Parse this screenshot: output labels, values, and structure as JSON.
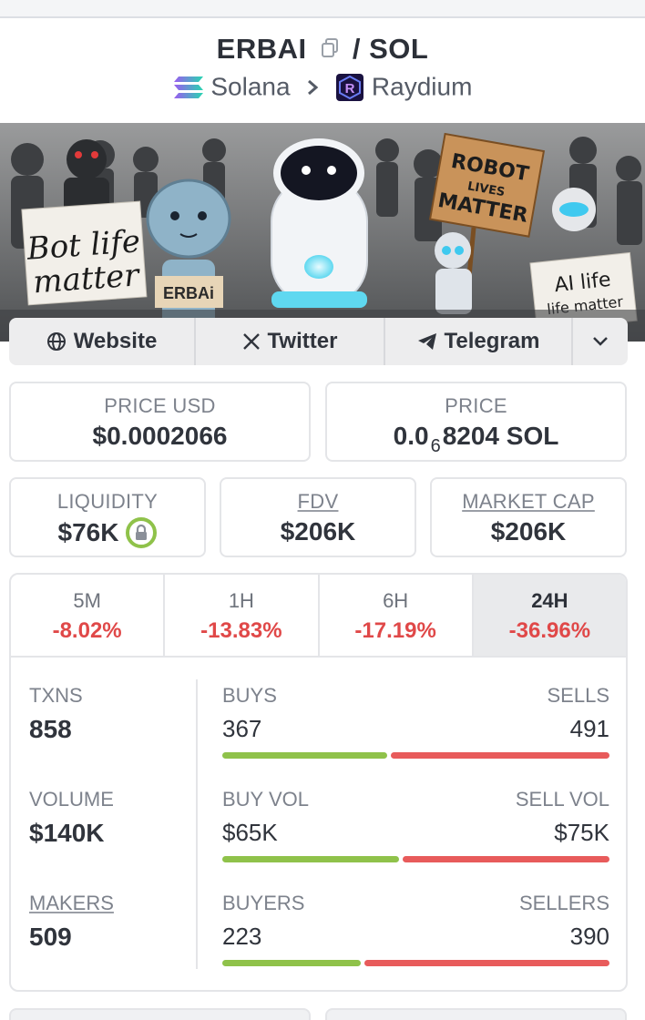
{
  "header": {
    "base_token": "ERBAI",
    "separator": "/",
    "quote_token": "SOL",
    "chain": "Solana",
    "dex": "Raydium"
  },
  "banner": {
    "sign_left": "Bot life matter",
    "sign_center": "ERBAi",
    "sign_top": "ROBOT LIVES MATTER",
    "sign_right": "AI life life matter"
  },
  "links": {
    "website": "Website",
    "twitter": "Twitter",
    "telegram": "Telegram"
  },
  "prices": {
    "usd_label": "PRICE USD",
    "usd_value": "$0.0002066",
    "native_label": "PRICE",
    "native_prefix": "0.0",
    "native_zeros": "6",
    "native_digits": "8204",
    "native_unit": "SOL"
  },
  "metrics": {
    "liquidity_label": "LIQUIDITY",
    "liquidity_value": "$76K",
    "fdv_label": "FDV",
    "fdv_value": "$206K",
    "mcap_label": "MARKET CAP",
    "mcap_value": "$206K"
  },
  "timeframes": [
    {
      "label": "5M",
      "change": "-8.02%"
    },
    {
      "label": "1H",
      "change": "-13.83%"
    },
    {
      "label": "6H",
      "change": "-17.19%"
    },
    {
      "label": "24H",
      "change": "-36.96%"
    }
  ],
  "active_timeframe": "24H",
  "stats": {
    "txns_label": "TXNS",
    "txns_value": "858",
    "volume_label": "VOLUME",
    "volume_value": "$140K",
    "makers_label": "MAKERS",
    "makers_value": "509",
    "buys_label": "BUYS",
    "buys_value": "367",
    "sells_label": "SELLS",
    "sells_value": "491",
    "buy_vol_label": "BUY VOL",
    "buy_vol_value": "$65K",
    "sell_vol_label": "SELL VOL",
    "sell_vol_value": "$75K",
    "buyers_label": "BUYERS",
    "buyers_value": "223",
    "sellers_label": "SELLERS",
    "sellers_value": "390"
  },
  "ratios": {
    "buys_fraction": 0.43,
    "buy_vol_fraction": 0.46,
    "buyers_fraction": 0.36
  },
  "colors": {
    "negative": "#e04848",
    "buy_bar": "#8fc24a",
    "sell_bar": "#e85b5b",
    "liquidity_lock": "#8fc24a"
  }
}
